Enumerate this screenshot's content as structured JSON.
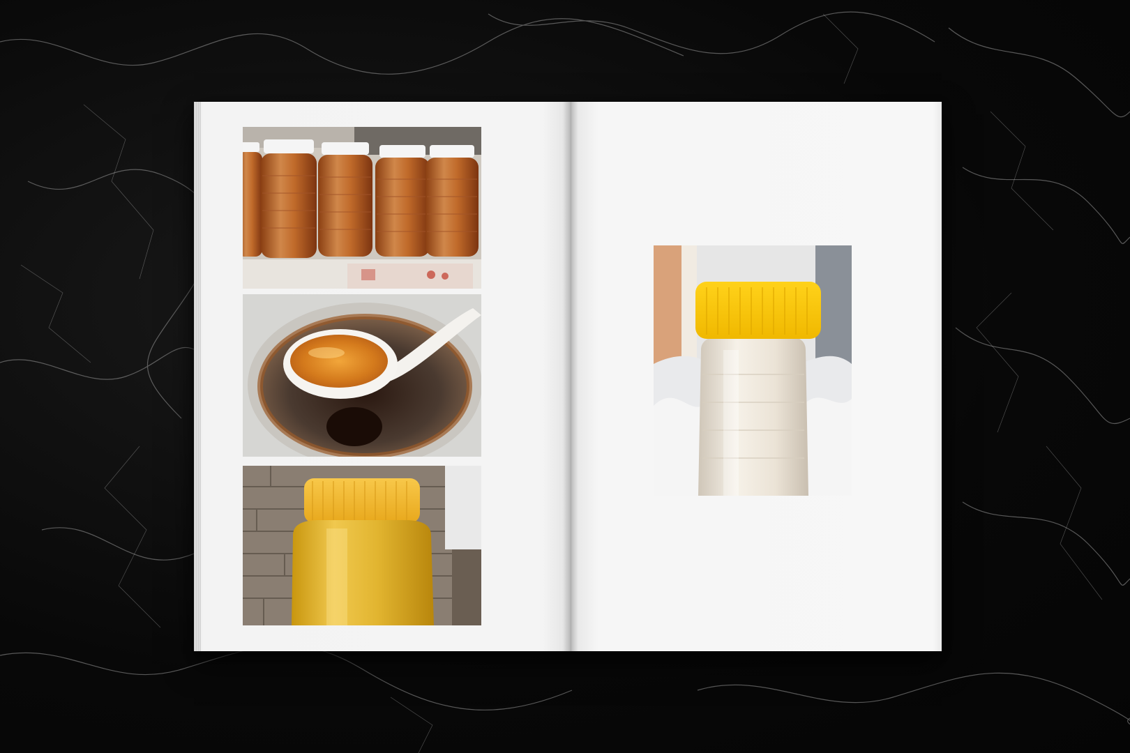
{
  "scene": {
    "background": "black-marble",
    "object": "open-book",
    "colors": {
      "marble_dark": "#0b0b0b",
      "marble_vein": "#8a8a8a",
      "page": "#f4f4f4",
      "honey_amber": "#c4742a",
      "honey_light": "#e6b84a",
      "cap_yellow": "#f2c400",
      "cream_honey": "#ece4d8"
    }
  },
  "left_page": {
    "photos": [
      {
        "subject": "row-of-amber-honey-jars"
      },
      {
        "subject": "spoon-of-honey-over-jar"
      },
      {
        "subject": "golden-honey-jar-yellow-cap"
      }
    ]
  },
  "right_page": {
    "photos": [
      {
        "subject": "crystallized-honey-jar-yellow-cap"
      }
    ]
  }
}
